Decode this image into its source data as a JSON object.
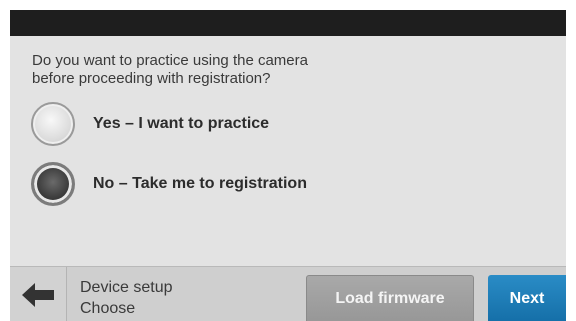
{
  "question": {
    "line1": "Do you want to practice using the camera",
    "line2": "before proceeding with registration?"
  },
  "options": [
    {
      "label": "Yes – I want to practice",
      "selected": false
    },
    {
      "label": "No – Take me to registration",
      "selected": true
    }
  ],
  "footer": {
    "back_icon": "arrow-left-icon",
    "breadcrumb": {
      "title": "Device setup",
      "step": "Choose"
    },
    "load_firmware_label": "Load firmware",
    "next_label": "Next"
  },
  "colors": {
    "accent": "#1b7fbd",
    "top_bar": "#1e1e1e",
    "panel": "#e3e3e3",
    "footer": "#cfcfcf",
    "secondary_button": "#9f9f9f"
  }
}
